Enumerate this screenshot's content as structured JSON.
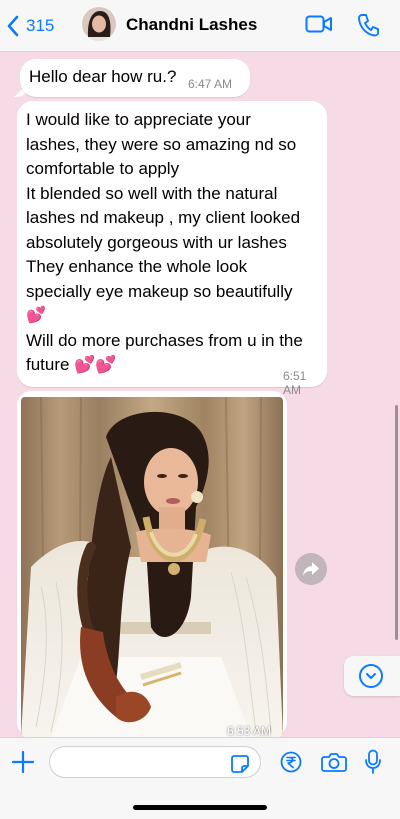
{
  "header": {
    "back_count": "315",
    "contact_name": "Chandni Lashes"
  },
  "messages": [
    {
      "text": "Hello dear how ru.?",
      "time": "6:47 AM"
    },
    {
      "lines": [
        "I would like to appreciate your",
        "lashes, they were  so amazing nd so",
        "comfortable to apply",
        "It blended so well with the natural",
        "lashes nd makeup , my client looked",
        "absolutely gorgeous with ur lashes",
        "They enhance the whole look",
        "specially eye makeup so beautifully",
        "💕",
        "Will do more purchases from u in the",
        "future 💕💕"
      ],
      "time": "6:51 AM"
    },
    {
      "type": "image",
      "time": "6:53 AM"
    }
  ],
  "input": {
    "value": "",
    "placeholder": ""
  },
  "colors": {
    "chat_background": "#f6dbe6",
    "accent": "#0a7bff",
    "bubble": "#ffffff",
    "timestamp": "#8a8a8e"
  },
  "icons": [
    "chevron-left-icon",
    "video-call-icon",
    "phone-icon",
    "plus-icon",
    "sticker-icon",
    "rupee-payment-icon",
    "camera-icon",
    "microphone-icon",
    "forward-icon",
    "chevron-down-icon"
  ]
}
